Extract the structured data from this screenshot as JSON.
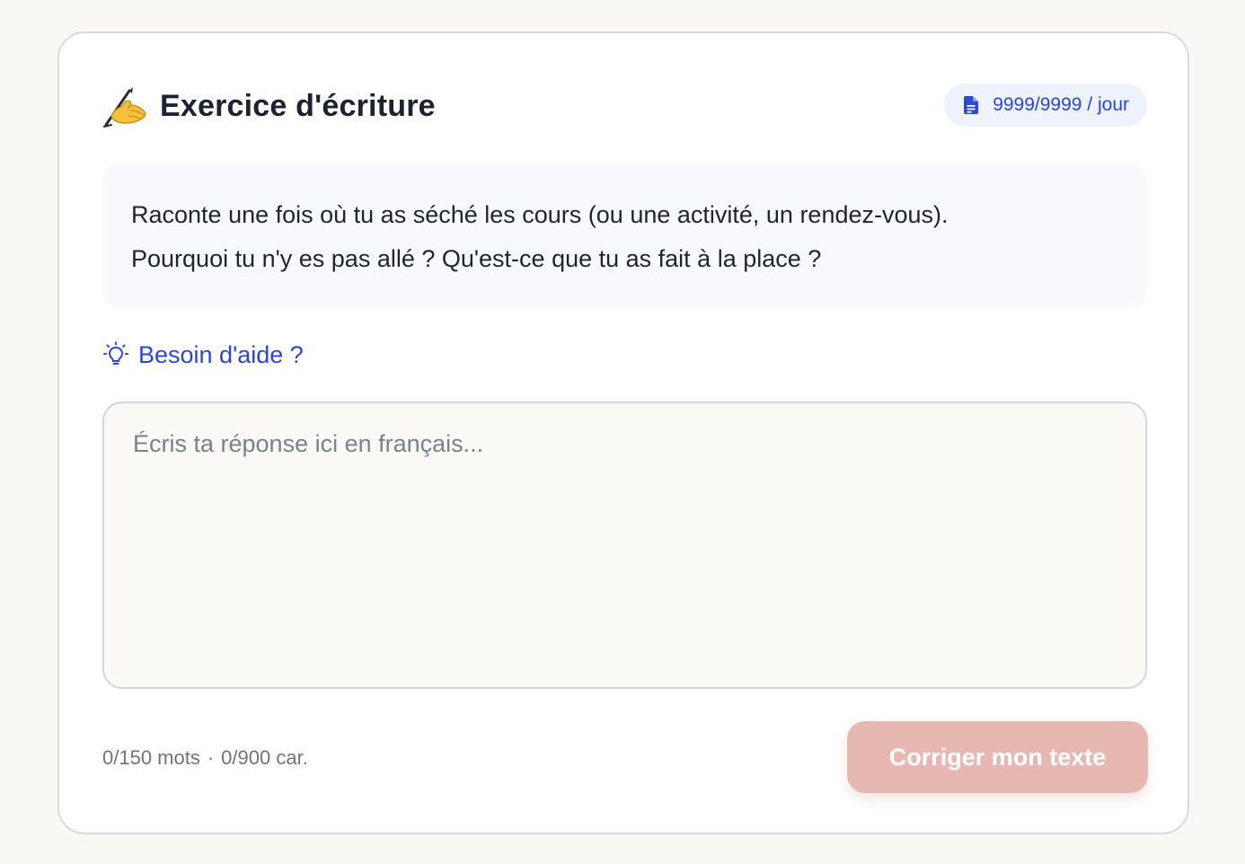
{
  "exercise": {
    "title": "Exercice d'écriture",
    "title_icon": "writing-hand-icon",
    "quota": {
      "icon": "document-icon",
      "text": "9999/9999 / jour"
    },
    "prompt": {
      "lines": [
        "Raconte une fois où tu as séché les cours (ou une activité, un rendez-vous).",
        "Pourquoi tu n'y es pas allé ? Qu'est-ce que tu as fait à la place ?"
      ]
    },
    "help": {
      "icon": "lightbulb-icon",
      "label": "Besoin d'aide ?"
    },
    "answer": {
      "value": "",
      "placeholder": "Écris ta réponse ici en français..."
    },
    "counter": {
      "words": "0/150 mots",
      "separator": "·",
      "chars": "0/900 car."
    },
    "submit": {
      "label": "Corriger mon texte",
      "disabled": true
    }
  },
  "colors": {
    "accent": "#2c46d8",
    "page_background": "#faf8f4",
    "prompt_background": "#f7f9fe",
    "badge_background": "#eef2fd",
    "button_disabled": "#e6b8b1"
  }
}
